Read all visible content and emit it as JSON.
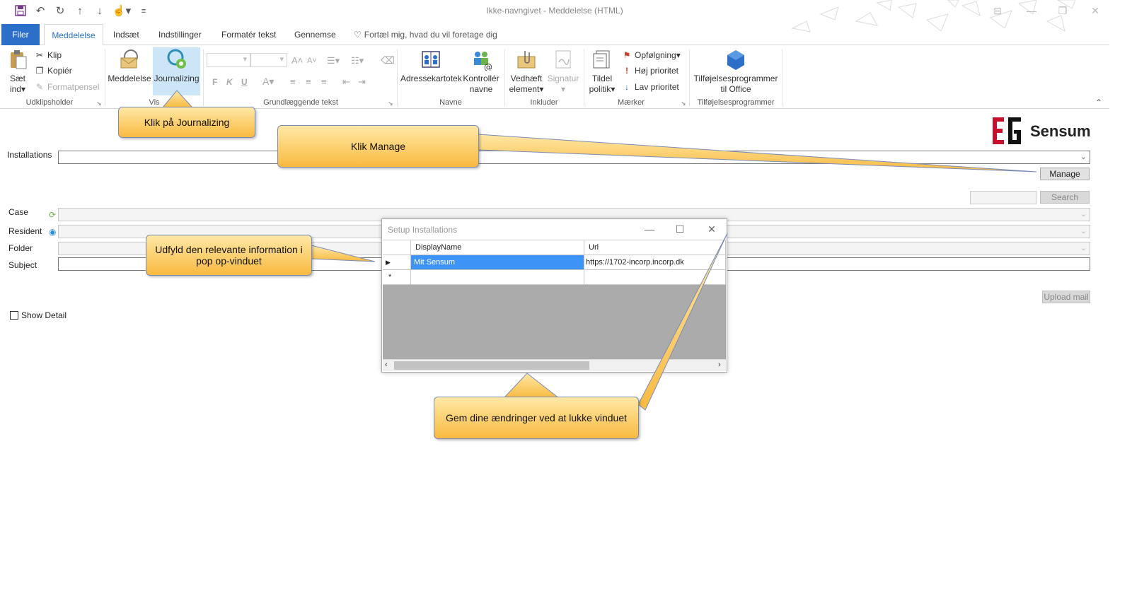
{
  "window": {
    "title": "Ikke-navngivet - Meddelelse (HTML)"
  },
  "quick_access": {
    "icons": [
      "save-icon",
      "undo-icon",
      "redo-icon",
      "up-icon",
      "down-icon",
      "touch-mode-icon",
      "customize-icon"
    ]
  },
  "tabs": [
    {
      "label": "Filer"
    },
    {
      "label": "Meddelelse"
    },
    {
      "label": "Indsæt"
    },
    {
      "label": "Indstillinger"
    },
    {
      "label": "Formatér tekst"
    },
    {
      "label": "Gennemse"
    }
  ],
  "tell_me": "Fortæl mig, hvad du vil foretage dig",
  "ribbon": {
    "clipboard": {
      "paste": "Sæt ind",
      "cut": "Klip",
      "copy": "Kopiér",
      "format_painter": "Formatpensel",
      "group": "Udklipsholder"
    },
    "vis": {
      "message": "Meddelelse",
      "journalizing": "Journalizing",
      "group": "Vis"
    },
    "basic_text": {
      "bold": "F",
      "italic": "K",
      "underline": "U",
      "font_color": "A",
      "group": "Grundlæggende tekst"
    },
    "names": {
      "address_book": "Adressekartotek",
      "check_names": "Kontrollér navne",
      "group": "Navne"
    },
    "include": {
      "attach": "Vedhæft element",
      "signature": "Signatur",
      "group": "Inkluder"
    },
    "tags": {
      "assign_policy": "Tildel politik",
      "follow_up": "Opfølgning",
      "high_priority": "Høj prioritet",
      "low_priority": "Lav prioritet",
      "group": "Mærker"
    },
    "addins": {
      "office_addins": "Tilføjelsesprogrammer til Office",
      "group": "Tilføjelsesprogrammer"
    }
  },
  "brand": {
    "logo_text": "EG",
    "name": "Sensum"
  },
  "form": {
    "installations_label": "Installations",
    "manage_button": "Manage",
    "search_button": "Search",
    "case_label": "Case",
    "resident_label": "Resident",
    "folder_label": "Folder",
    "subject_label": "Subject",
    "upload_button": "Upload mail",
    "show_detail": "Show Detail"
  },
  "dialog": {
    "title": "Setup Installations",
    "columns": [
      "DisplayName",
      "Url"
    ],
    "rows": [
      {
        "marker": "▶",
        "display_name": "Mit Sensum",
        "url": "https://1702-incorp.incorp.dk"
      },
      {
        "marker": "*",
        "display_name": "",
        "url": ""
      }
    ]
  },
  "callouts": {
    "journalizing": "Klik på Journalizing",
    "manage": "Klik Manage",
    "fill_in": "Udfyld den relevante information i pop op-vinduet",
    "save": "Gem dine ændringer ved at lukke vinduet"
  },
  "colors": {
    "accent": "#2b6fc9",
    "selected_row": "#3d94f6",
    "callout_top": "#ffe8a6",
    "callout_bottom": "#f8ba40",
    "journalizing_highlight": "#cde6f7"
  }
}
